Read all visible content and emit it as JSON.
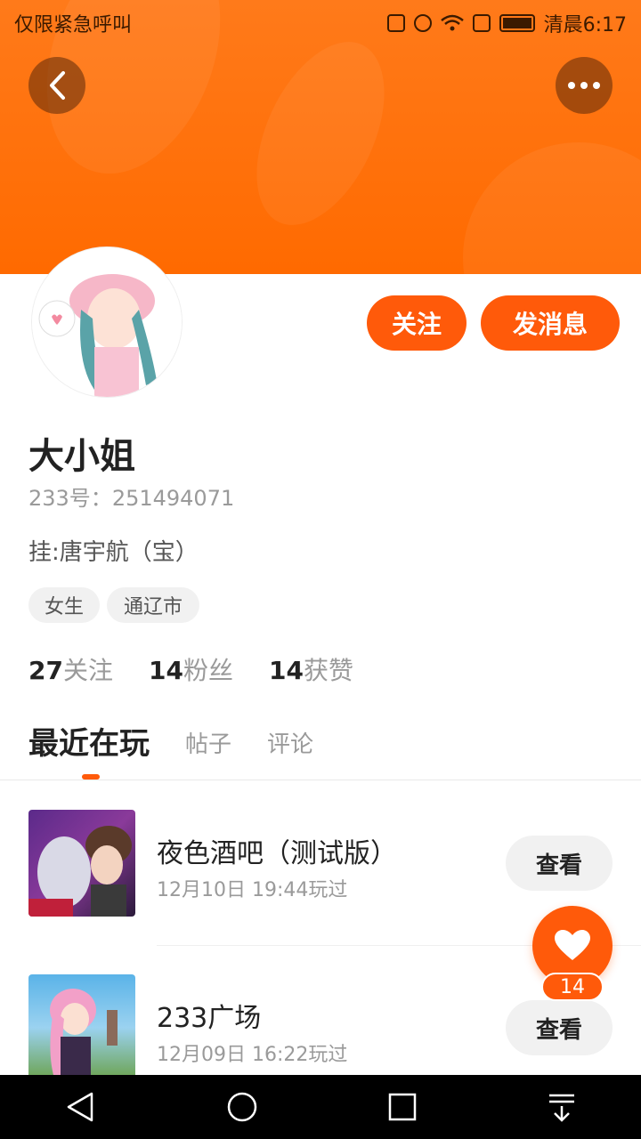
{
  "status_bar": {
    "carrier_text": "仅限紧急呼叫",
    "time": "清晨6:17"
  },
  "header": {
    "back_icon": "chevron-left-icon",
    "more_icon": "more-horizontal-icon"
  },
  "profile": {
    "name": "大小姐",
    "uid_label": "233号：",
    "uid_value": "251494071",
    "bio": "挂:唐宇航（宝）",
    "tags": [
      "女生",
      "通辽市"
    ],
    "follow_button": "关注",
    "message_button": "发消息"
  },
  "stats": [
    {
      "value": "27",
      "label": "关注"
    },
    {
      "value": "14",
      "label": "粉丝"
    },
    {
      "value": "14",
      "label": "获赞"
    }
  ],
  "tabs": [
    {
      "label": "最近在玩",
      "active": true
    },
    {
      "label": "帖子",
      "active": false
    },
    {
      "label": "评论",
      "active": false
    }
  ],
  "games": [
    {
      "title": "夜色酒吧（测试版）",
      "time": "12月10日 19:44玩过",
      "button": "查看"
    },
    {
      "title": "233广场",
      "time": "12月09日 16:22玩过",
      "button": "查看"
    }
  ],
  "floating_like": {
    "icon": "heart-icon",
    "count": "14"
  },
  "colors": {
    "accent": "#ff5a0a",
    "header": "#ff7a1a"
  }
}
